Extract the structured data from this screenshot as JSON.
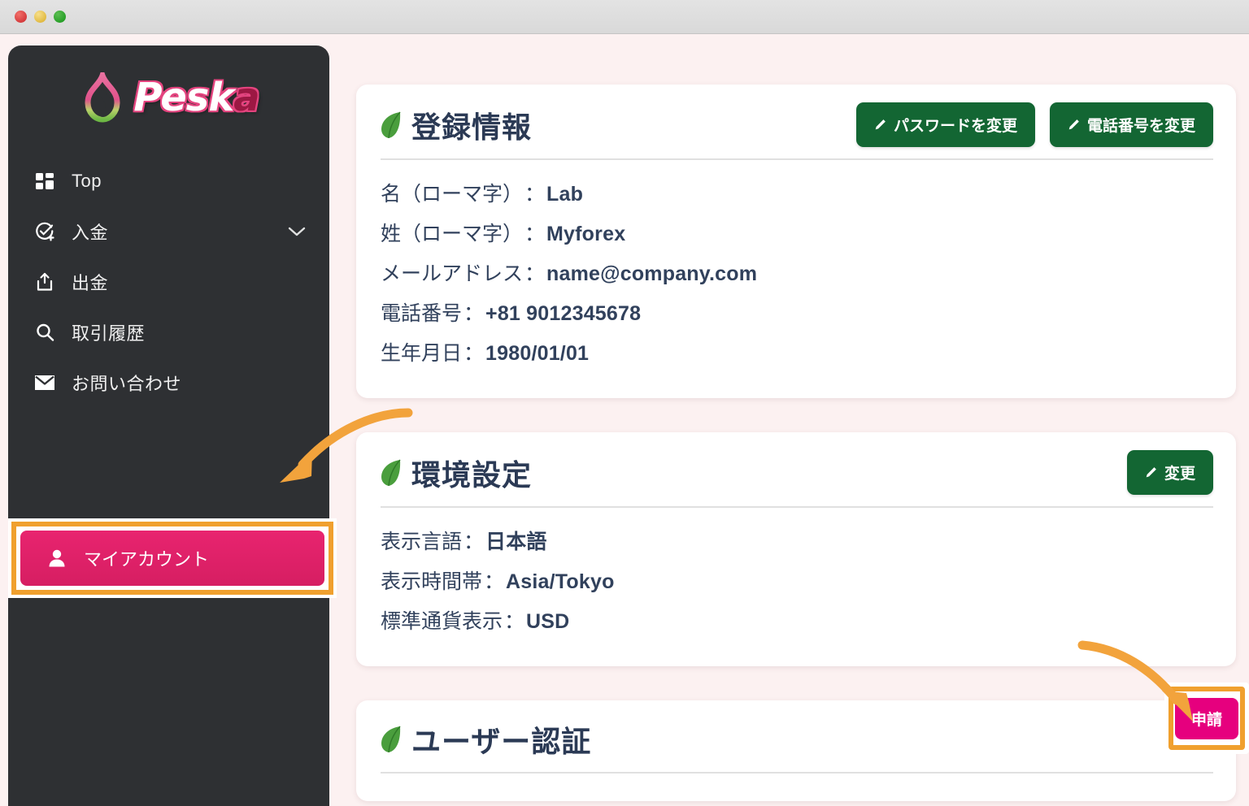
{
  "window": {
    "traffic_lights": [
      "close-button",
      "minimize-button",
      "zoom-button"
    ]
  },
  "sidebar": {
    "logo": {
      "text": "Peska",
      "accent_letter": "a",
      "mark": "peach-logo-icon"
    },
    "items": [
      {
        "label": "Top",
        "icon": "dashboard-icon",
        "active": false,
        "has_chevron": false
      },
      {
        "label": "入金",
        "icon": "deposit-icon",
        "active": false,
        "has_chevron": true
      },
      {
        "label": "出金",
        "icon": "withdraw-icon",
        "active": false,
        "has_chevron": false
      },
      {
        "label": "取引履歴",
        "icon": "search-icon",
        "active": false,
        "has_chevron": false
      },
      {
        "label": "お問い合わせ",
        "icon": "mail-icon",
        "active": false,
        "has_chevron": false
      },
      {
        "label": "マイアカウント",
        "icon": "user-icon",
        "active": true,
        "has_chevron": false
      }
    ]
  },
  "main": {
    "registration": {
      "title": "登録情報",
      "leaf_icon": "leaf-icon",
      "buttons": [
        {
          "label": "パスワードを変更",
          "icon": "pencil-icon"
        },
        {
          "label": "電話番号を変更",
          "icon": "pencil-icon"
        }
      ],
      "rows": [
        {
          "key": "名（ローマ字）",
          "sep": "：",
          "value": "Lab"
        },
        {
          "key": "姓（ローマ字）",
          "sep": "：",
          "value": "Myforex"
        },
        {
          "key": "メールアドレス",
          "sep": "：",
          "value": "name@company.com"
        },
        {
          "key": "電話番号",
          "sep": "：",
          "value": "+81 9012345678"
        },
        {
          "key": "生年月日",
          "sep": "：",
          "value": "1980/01/01"
        }
      ]
    },
    "preferences": {
      "title": "環境設定",
      "leaf_icon": "leaf-icon",
      "button": {
        "label": "変更",
        "icon": "pencil-icon"
      },
      "rows": [
        {
          "key": "表示言語",
          "sep": "：",
          "value": "日本語"
        },
        {
          "key": "表示時間帯",
          "sep": "：",
          "value": "Asia/Tokyo"
        },
        {
          "key": "標準通貨表示",
          "sep": "：",
          "value": "USD"
        }
      ]
    },
    "verification": {
      "title": "ユーザー認証",
      "leaf_icon": "leaf-icon",
      "button": {
        "label": "申請"
      }
    }
  },
  "annotations": {
    "arrows": [
      {
        "name": "arrow-to-my-account",
        "color": "#f2a33c"
      },
      {
        "name": "arrow-to-apply-button",
        "color": "#f2a33c"
      }
    ],
    "highlight_color": "#f0a02e"
  },
  "colors": {
    "sidebar_bg": "#2e3033",
    "page_bg": "#fcf1f1",
    "accent_pink": "#e6007e",
    "active_pink": "#e8246f",
    "green": "#136633",
    "title_navy": "#2b3a55",
    "annotation_orange": "#f0a02e"
  }
}
